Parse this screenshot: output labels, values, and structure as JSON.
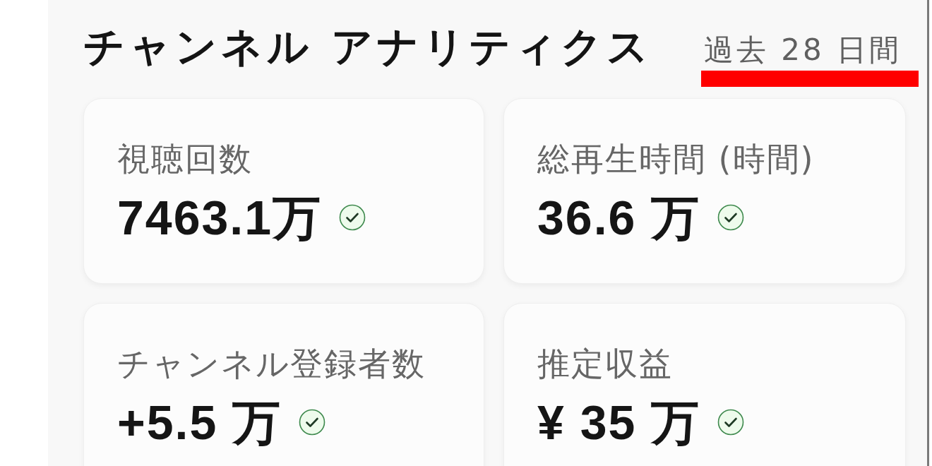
{
  "header": {
    "title": "チャンネル アナリティクス",
    "period": "過去 28 日間"
  },
  "metrics": [
    {
      "label": "視聴回数",
      "value": "7463.1万",
      "verified": true
    },
    {
      "label": "総再生時間 (時間)",
      "value": "36.6 万",
      "verified": true
    },
    {
      "label": "チャンネル登録者数",
      "value": "+5.5 万",
      "verified": true
    },
    {
      "label": "推定収益",
      "value": "¥ 35 万",
      "verified": true
    }
  ]
}
